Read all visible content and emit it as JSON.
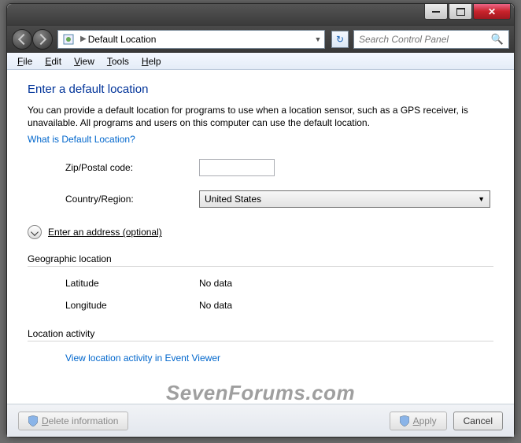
{
  "window": {
    "breadcrumb_location": "Default Location",
    "search_placeholder": "Search Control Panel"
  },
  "menu": {
    "file": "File",
    "edit": "Edit",
    "view": "View",
    "tools": "Tools",
    "help": "Help"
  },
  "page": {
    "heading": "Enter a default location",
    "description": "You can provide a default location for programs to use when a location sensor, such as a GPS receiver, is unavailable. All programs and users on this computer can use the default location.",
    "help_link": "What is Default Location?",
    "zip_label": "Zip/Postal code:",
    "zip_value": "",
    "country_label": "Country/Region:",
    "country_value": "United States",
    "expander_label": "Enter an address (optional)",
    "geo_section": "Geographic location",
    "latitude_label": "Latitude",
    "latitude_value": "No data",
    "longitude_label": "Longitude",
    "longitude_value": "No data",
    "activity_section": "Location activity",
    "activity_link": "View location activity in Event Viewer"
  },
  "buttons": {
    "delete": "Delete information",
    "apply": "Apply",
    "cancel": "Cancel"
  },
  "watermark": "SevenForums.com"
}
